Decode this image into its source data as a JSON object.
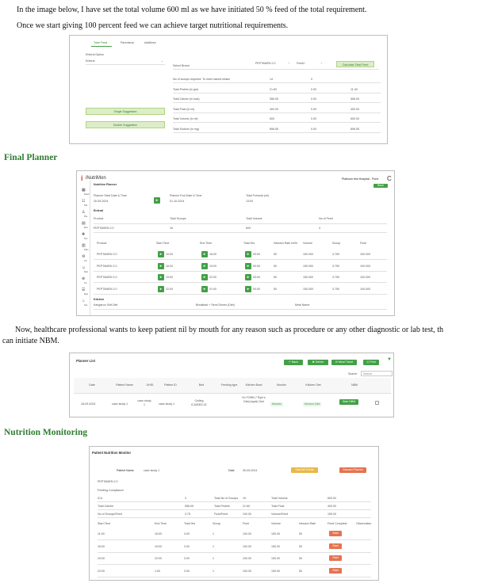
{
  "text": {
    "p1": "In the image below, I have set the total volume 600 ml as we have initiated 50 % feed of the total requirement.",
    "p2": "Once we start giving 100 percent feed we can achieve target nutritional requirements.",
    "h_final": "Final Planner",
    "p3a": "Now, healthcare professional wants to keep patient nil by mouth for any reason such as procedure or any other diagnostic or lab test, th",
    "p3b": "can initiate NBM.",
    "h_monitor": "Nutrition Monitoring"
  },
  "s1": {
    "tabs": [
      "Tube Feed",
      "Parenteral",
      "Additives"
    ],
    "left_label": "Enteral Option",
    "left_value": "Enteral",
    "select_label": "Select Brand",
    "brand": "PEPTAMEN 2.0",
    "feed": "Feed2",
    "calc_btn": "Calculate Total Feed",
    "btn_single": "Single Suggestion",
    "btn_double": "Double Suggestion",
    "rows": [
      {
        "label": "No of scoops required: To meet calorie intake",
        "a": "14",
        "b": "0",
        "c": ""
      },
      {
        "label": "Total Protein (in gm)",
        "a": "21.60",
        "b": "0.00",
        "c": "11.40"
      },
      {
        "label": "Total Calorie (in kcal)",
        "a": "556.05",
        "b": "0.00",
        "c": "556.05"
      },
      {
        "label": "Total Fluid (in ml)",
        "a": "400.00",
        "b": "0.00",
        "c": "400.00"
      },
      {
        "label": "Total Volume (in ml)",
        "a": "600",
        "b": "0.00",
        "c": "600.00"
      },
      {
        "label": "Total Sodium (in mg)",
        "a": "896.55",
        "b": "0.00",
        "c": "896.55"
      }
    ]
  },
  "s2": {
    "logo": "iNutriMon",
    "logo_i": "i",
    "subtitle": "Nutrition Planner",
    "hospital": "Platinum test Hospital - Pune",
    "top_btn": "Back",
    "fields": [
      {
        "label": "Planner Start Date & Time",
        "value": "30-09-2024"
      },
      {
        "label": "Planner End Date & Time",
        "value": "01-10-2024"
      },
      {
        "label": "Total Formula (ml)",
        "value": "13:00"
      }
    ],
    "enteral": "Enteral",
    "prod_headers": [
      "Product",
      "Total Scoops",
      "Total Volume",
      "No of Feed"
    ],
    "prod_row": [
      "PEPTAMEN 2.0",
      "16",
      "600",
      "4"
    ],
    "table_headers": [
      "Product",
      "Start Time",
      "End Time",
      "Total Hrs",
      "Infusion Rate ml/hr",
      "Volume",
      "Scoop",
      "Fluid"
    ],
    "table_rows": [
      [
        "PEPTAMEN 2.0",
        "10:00",
        "16:00",
        "00:00",
        "50",
        "150.000",
        "3.750",
        "100.000"
      ],
      [
        "PEPTAMEN 2.0",
        "16:00",
        "19:00",
        "00:00",
        "50",
        "150.000",
        "3.750",
        "100.000"
      ],
      [
        "PEPTAMEN 2.0",
        "19:00",
        "22:00",
        "00:00",
        "50",
        "150.000",
        "3.750",
        "100.000"
      ],
      [
        "PEPTAMEN 2.0",
        "22:00",
        "01:00",
        "00:00",
        "50",
        "150.000",
        "3.750",
        "100.000"
      ]
    ],
    "kitchen": "Kitchen",
    "kitchen_vals": [
      "Kangaroo Soft Diet",
      "Breakfast + Semi Dinner (Diet)",
      "Meal Name"
    ],
    "sidebar": [
      "Dash",
      "Pat",
      "Pla",
      "Rec",
      "Nur",
      "Plan",
      "Ch",
      "Diet",
      "Inv",
      "Rep",
      "Set"
    ]
  },
  "s3": {
    "title": "Planner List",
    "buttons": [
      {
        "label": "Back",
        "icon": "back-icon"
      },
      {
        "label": "Delete",
        "icon": "delete-icon"
      },
      {
        "label": "Meal Ticket",
        "icon": "ticket-icon"
      },
      {
        "label": "Print",
        "icon": "print-icon"
      }
    ],
    "search_label": "Search",
    "search_placeholder": "Search",
    "headers": [
      "Date",
      "Patient Name",
      "UHID",
      "Patient ID",
      "Bed",
      "Feeding type",
      "Kitchen Bowl",
      "Monitor",
      "Kitchen Diet",
      "NBM"
    ],
    "row": {
      "date": "18-09-2024",
      "patient": "case study 1",
      "uhid": "case study 1",
      "pid": "case study 1",
      "bed": "Ceiling ICU/BED-01",
      "feeding": "",
      "kitchen": "Ex FORB-7 Ryle's Diet(Liquid) Diet",
      "monitor": "Monitor",
      "diet": "Kitchen Diet",
      "nbm": "Start NBM"
    }
  },
  "s4": {
    "title": "Patient Nutrition Monitor",
    "patient_label": "Patient Name",
    "patient_value": "case study 1",
    "date_label": "Date",
    "date_value": "30-09-2024",
    "btn_yellow": "Start All Feeds",
    "btn_red": "Discard Planner",
    "product": "PEPTAMEN 2.0",
    "subhead": "Feeding Compliance",
    "stats": [
      [
        "ICU",
        "3",
        "Total No of Scoops",
        "15",
        "Total Volume",
        "600.00"
      ],
      [
        "Total Calorie",
        "556.05",
        "Total Protein",
        "21.60",
        "Total Fluid",
        "400.00"
      ],
      [
        "No of Scoops/Feed",
        "3.75",
        "Fluid/Feed",
        "100.00",
        "Volume/Feed",
        "150.00"
      ]
    ],
    "headers": [
      "Start Time",
      "End Time",
      "Total Hrs",
      "Scoop",
      "Fluid",
      "Volume",
      "Infusion Rate",
      "Feed Complete",
      "Observation"
    ],
    "rows": [
      [
        "11:00",
        "15:00",
        "3.00",
        "1",
        "100.00",
        "150.00",
        "50",
        "Start"
      ],
      [
        "16:00",
        "19:00",
        "3.00",
        "1",
        "100.00",
        "150.00",
        "50",
        "Start"
      ],
      [
        "19:00",
        "22:00",
        "3.00",
        "1",
        "100.00",
        "150.00",
        "50",
        "Start"
      ],
      [
        "22:00",
        "1:00",
        "3.00",
        "1",
        "100.00",
        "150.00",
        "50",
        "Start"
      ]
    ]
  }
}
